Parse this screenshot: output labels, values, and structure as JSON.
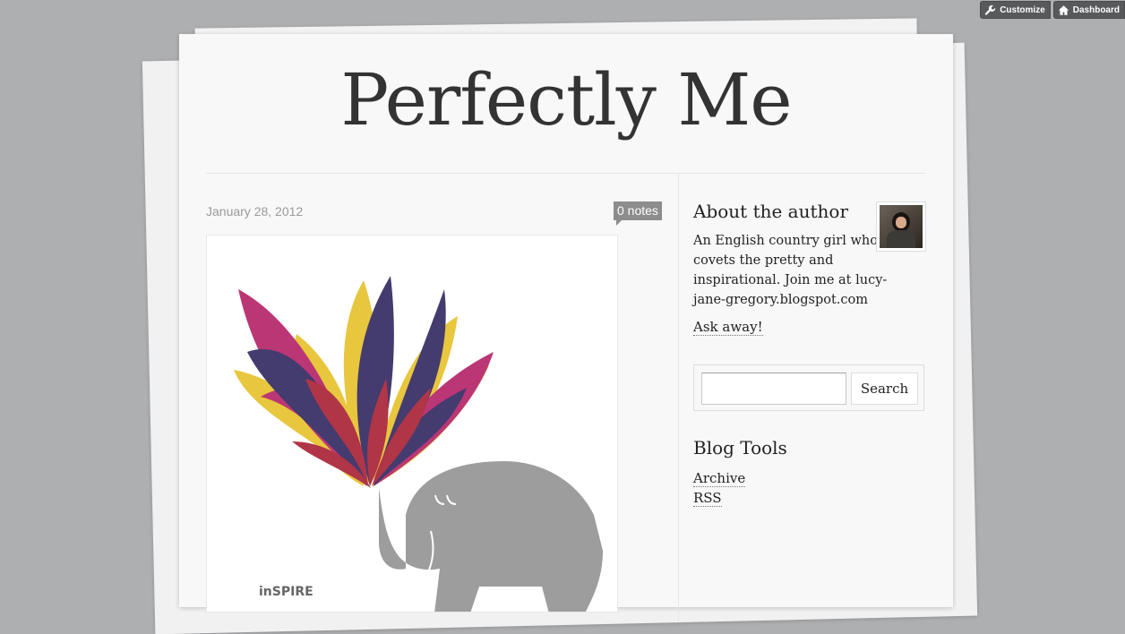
{
  "controls": {
    "customize_label": "Customize",
    "dashboard_label": "Dashboard"
  },
  "blog": {
    "title": "Perfectly Me"
  },
  "post": {
    "date": "January 28, 2012",
    "notes": "0 notes",
    "image_text": "inSPIRE"
  },
  "sidebar": {
    "about_title": "About the author",
    "about_text": "An English country girl who covets the pretty and inspirational. Join me at lucy-jane-gregory.blogspot.com",
    "ask_label": "Ask away!",
    "search": {
      "value": "",
      "button_label": "Search"
    },
    "tools_title": "Blog Tools",
    "tools": [
      {
        "label": "Archive"
      },
      {
        "label": "RSS"
      }
    ]
  },
  "colors": {
    "background": "#aeafb1",
    "paper": "#f8f8f8",
    "notes_badge": "#8d8d8d",
    "control_bg": "#58595b",
    "petal_yellow": "#e4bd1c",
    "petal_magenta": "#b0145e",
    "petal_navy": "#241a57",
    "petal_red": "#a31228",
    "elephant_grey": "#9d9d9d"
  }
}
